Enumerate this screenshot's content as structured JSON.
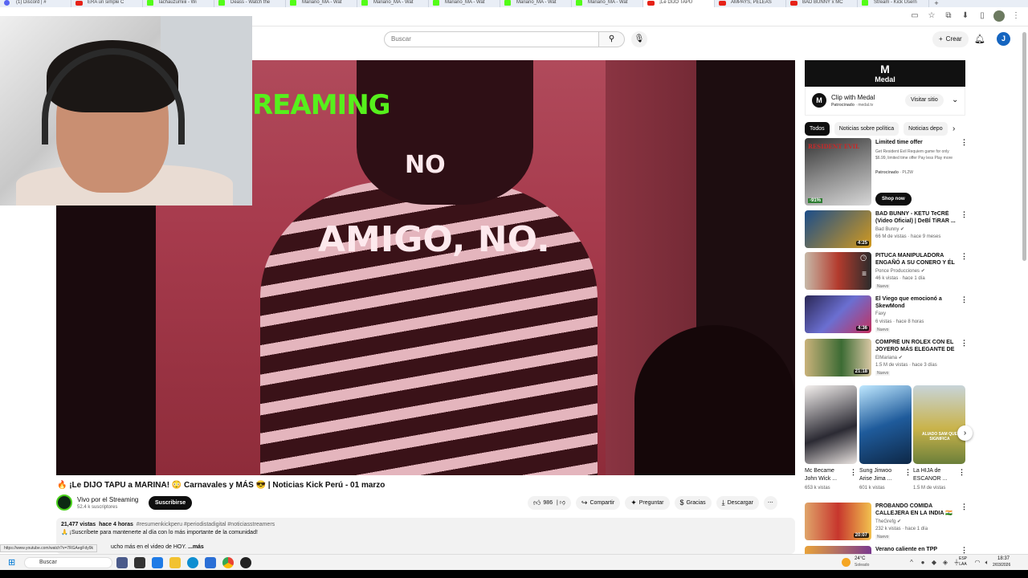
{
  "browser": {
    "tabs": [
      {
        "label": "(1) Discord | #",
        "icon": "discord"
      },
      {
        "label": "ERA un simple C",
        "icon": "youtube"
      },
      {
        "label": "lachauzumiiii - Wi",
        "icon": "kick"
      },
      {
        "label": "Deass - Watch the",
        "icon": "kick"
      },
      {
        "label": "Mariano_MA - Wat",
        "icon": "kick"
      },
      {
        "label": "Mariano_MA - Wat",
        "icon": "kick"
      },
      {
        "label": "Mariano_MA - Wat",
        "icon": "kick"
      },
      {
        "label": "Mariano_MA - Wat",
        "icon": "kick"
      },
      {
        "label": "Mariano_MA - Wat",
        "icon": "kick"
      },
      {
        "label": "¡Le DIJO TAPU",
        "icon": "youtube",
        "active": true
      },
      {
        "label": "AMPAYS, PELEAS",
        "icon": "youtube"
      },
      {
        "label": "BAD BUNNY x MC",
        "icon": "youtube"
      },
      {
        "label": "Stream - Kick Usern",
        "icon": "kick"
      }
    ],
    "new_tab_label": "+",
    "status_url": "https://www.youtube.com/watch?v=7RGAegFdy9k"
  },
  "header": {
    "search_placeholder": "Buscar",
    "create_label": "Crear",
    "avatar_letter": "J"
  },
  "player": {
    "overlay_green": "REAMING",
    "overlay_no": "NO",
    "overlay_amigo": "AMIGO, NO."
  },
  "video": {
    "title": "🔥 ¡Le DIJO TAPU a MARINA! 😳 Carnavales y MÁS 😎 | Noticias Kick Perú - 01 marzo",
    "channel_name": "Vivo por el Streaming",
    "subscribers": "52.4 k suscriptores",
    "subscribe_label": "Suscribirse",
    "likes": "986",
    "share_label": "Compartir",
    "ask_label": "Preguntar",
    "thanks_label": "Gracias",
    "download_label": "Descargar",
    "views": "21,477 vistas",
    "age": "hace 4 horas",
    "hashtags": "#resumenkickperu #periodistadigital #noticiasstreamers",
    "desc_line1": "🙏 ¡Suscríbete para mantenerte al día con lo más importante de la comunidad!",
    "desc_line2": "ucho más en el video de HOY. ",
    "more_label": "...más"
  },
  "sidebar": {
    "ad": {
      "brand": "Medal",
      "title": "Clip with Medal",
      "sponsor": "Patrocinado",
      "domain": "medal.tv",
      "visit_label": "Visitar sitio"
    },
    "chips": [
      "Todos",
      "Noticias sobre política",
      "Noticias depo"
    ],
    "promo": {
      "thumb_text": "RESIDENT EVIL",
      "discount": "-91%",
      "title": "Limited time offer",
      "desc": "Get Resident Evil Requiem game for only $6.99, limited time offer Pay less Play more",
      "sponsor": "Patrocinado",
      "advertiser": "PL2W",
      "shop_label": "Shop now"
    },
    "videos": [
      {
        "title": "BAD BUNNY - KETU TeCRÉ (Video Oficial) | DeBÍ TiRAR ...",
        "channel": "Bad Bunny",
        "meta": "66 M de vistas · hace 9 meses",
        "duration": "4:25",
        "badge": ""
      },
      {
        "title": "PITUCA MANIPULADORA ENGAÑÓ A SU CONERO Y ÉL ...",
        "channel": "Ponce Producciones",
        "meta": "46 k vistas · hace 1 día",
        "duration": "",
        "badge": "Nuevo"
      },
      {
        "title": "El Viego que emocionó a SkewMond",
        "channel": "Faxy",
        "meta": "6 vistas · hace 8 horas",
        "duration": "4:36",
        "badge": "Nuevo"
      },
      {
        "title": "COMPRÉ UN ROLEX CON EL JOYERO MÁS ELEGANTE DE ...",
        "channel": "ElMariana",
        "meta": "1.5 M de vistas · hace 3 días",
        "duration": "21:18",
        "badge": "Nuevo"
      }
    ],
    "shorts": [
      {
        "title": "Mc Became John Wick ...",
        "views": "653 k vistas"
      },
      {
        "title": "Sung Jinwoo Arise Jima ...",
        "views": "601 k vistas"
      },
      {
        "title": "La HIJA de ESCANOR ...",
        "views": "1.5 M de vistas",
        "thumb_text": "ALIADO SAM QUE SIGNIFICA"
      }
    ],
    "more_videos": [
      {
        "title": "PROBANDO COMIDA CALLEJERA EN LA INDIA 🇮🇳",
        "channel": "TheGrefg",
        "meta": "232 k vistas · hace 1 día",
        "duration": "20:07",
        "badge": "Nuevo"
      },
      {
        "title": "Verano caliente en TPP",
        "channel": "",
        "meta": "",
        "duration": "",
        "badge": ""
      }
    ]
  },
  "taskbar": {
    "search_label": "Buscar",
    "temperature": "24°C",
    "weather": "Soleado",
    "lang_top": "ESP",
    "lang_bottom": "LAA",
    "time": "18:37",
    "date": "2/03/2026"
  }
}
